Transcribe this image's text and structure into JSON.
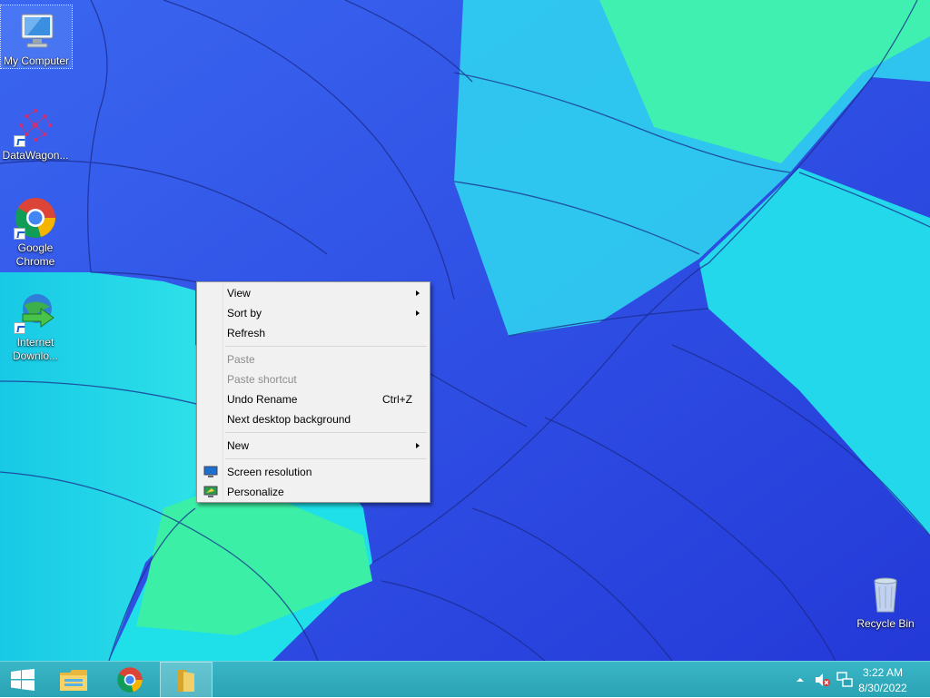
{
  "desktop": {
    "icons": [
      {
        "label": "My Computer",
        "icon": "computer-icon"
      },
      {
        "label": "DataWagon...",
        "icon": "datawagon-icon"
      },
      {
        "label": "Google Chrome",
        "icon": "chrome-icon"
      },
      {
        "label": "Internet Downlo...",
        "icon": "idm-icon"
      },
      {
        "label": "Recycle Bin",
        "icon": "recycle-bin-icon"
      }
    ]
  },
  "context_menu": {
    "items": [
      {
        "label": "View",
        "submenu": true
      },
      {
        "label": "Sort by",
        "submenu": true
      },
      {
        "label": "Refresh"
      },
      {
        "label": "Paste",
        "disabled": true
      },
      {
        "label": "Paste shortcut",
        "disabled": true
      },
      {
        "label": "Undo Rename",
        "shortcut": "Ctrl+Z"
      },
      {
        "label": "Next desktop background"
      },
      {
        "label": "New",
        "submenu": true
      },
      {
        "label": "Screen resolution",
        "icon": "screen-resolution-icon"
      },
      {
        "label": "Personalize",
        "icon": "personalize-icon"
      }
    ]
  },
  "taskbar": {
    "buttons": [
      "start-icon",
      "file-explorer-icon",
      "chrome-icon",
      "folder-icon"
    ],
    "tray": {
      "time": "3:22 AM",
      "date": "8/30/2022",
      "icons": [
        "show-hidden-icons-chevron",
        "volume-muted-icon",
        "network-icon"
      ]
    }
  },
  "colors": {
    "taskbar": "#2aa3b4",
    "menu_bg": "#f1f1f1",
    "wallpaper_blue": "#2f4fe6",
    "wallpaper_cyan": "#1ad8e8",
    "wallpaper_green": "#33f0a8"
  }
}
